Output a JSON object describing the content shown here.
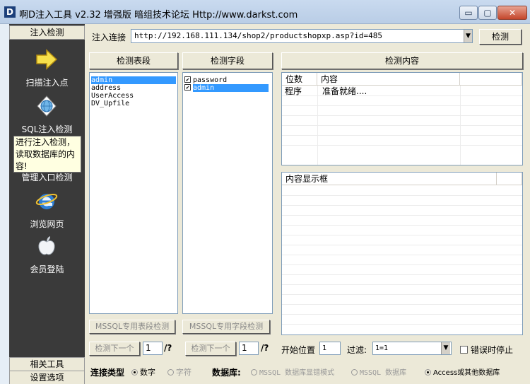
{
  "window": {
    "logo_letter": "D",
    "title": "啊D注入工具 v2.32 增强版 暗组技术论坛 Http://www.darkst.com",
    "minimize_glyph": "▭",
    "maximize_glyph": "▢",
    "close_glyph": "✕"
  },
  "sidebar": {
    "tab_inject": "注入检测",
    "items": [
      {
        "label": "扫描注入点",
        "icon": "arrow-right-icon"
      },
      {
        "label": "SQL注入检测",
        "icon": "globe-icon"
      },
      {
        "label": "管理入口检测",
        "icon": "folder-icon"
      },
      {
        "label": "浏览网页",
        "icon": "ie-browser-icon"
      },
      {
        "label": "会员登陆",
        "icon": "apple-icon"
      }
    ],
    "tooltip": "进行注入检测，读取数据库的内容!",
    "tab_tools": "相关工具",
    "tab_settings": "设置选项"
  },
  "url_bar": {
    "label": "注入连接",
    "value": "http://192.168.111.134/shop2/productshopxp.asp?id=485",
    "dropdown_glyph": "▼",
    "detect_label": "检测"
  },
  "tables_panel": {
    "header": "检测表段",
    "items": [
      "admin",
      "address",
      "UserAccess",
      "DV_Upfile"
    ],
    "selected_index": 0,
    "mssql_button": "MSSQL专用表段检测",
    "next_button": "检测下一个",
    "page_value": "1",
    "page_total": "/?"
  },
  "fields_panel": {
    "header": "检测字段",
    "items": [
      {
        "label": "password",
        "checked": true
      },
      {
        "label": "admin",
        "checked": true
      }
    ],
    "selected_index": 1,
    "check_glyph": "✔",
    "mssql_button": "MSSQL专用字段检测",
    "next_button": "检测下一个",
    "page_value": "1",
    "page_total": "/?"
  },
  "content_panel": {
    "header": "检测内容",
    "columns": [
      "位数",
      "内容"
    ],
    "rows": [
      [
        "程序",
        "准备就绪...."
      ]
    ],
    "display_header": "内容显示框"
  },
  "options": {
    "start_pos_label": "开始位置",
    "start_pos_value": "1",
    "filter_label": "过滤:",
    "filter_value": "1=1",
    "filter_dropdown_glyph": "▼",
    "stop_on_error": "错误时停止",
    "stop_on_error_checked": false
  },
  "connection": {
    "type_label": "连接类型",
    "type_options": [
      "数字",
      "字符"
    ],
    "type_selected": 0,
    "db_label": "数据库:",
    "db_options": [
      "MSSQL 数据库显错模式",
      "MSSQL 数据库",
      "Access或其他数据库"
    ],
    "db_selected": 2
  },
  "colors": {
    "selection": "#3399ff",
    "sidebar_bg": "#3a3a3a",
    "tooltip_bg": "#ffffe1"
  }
}
